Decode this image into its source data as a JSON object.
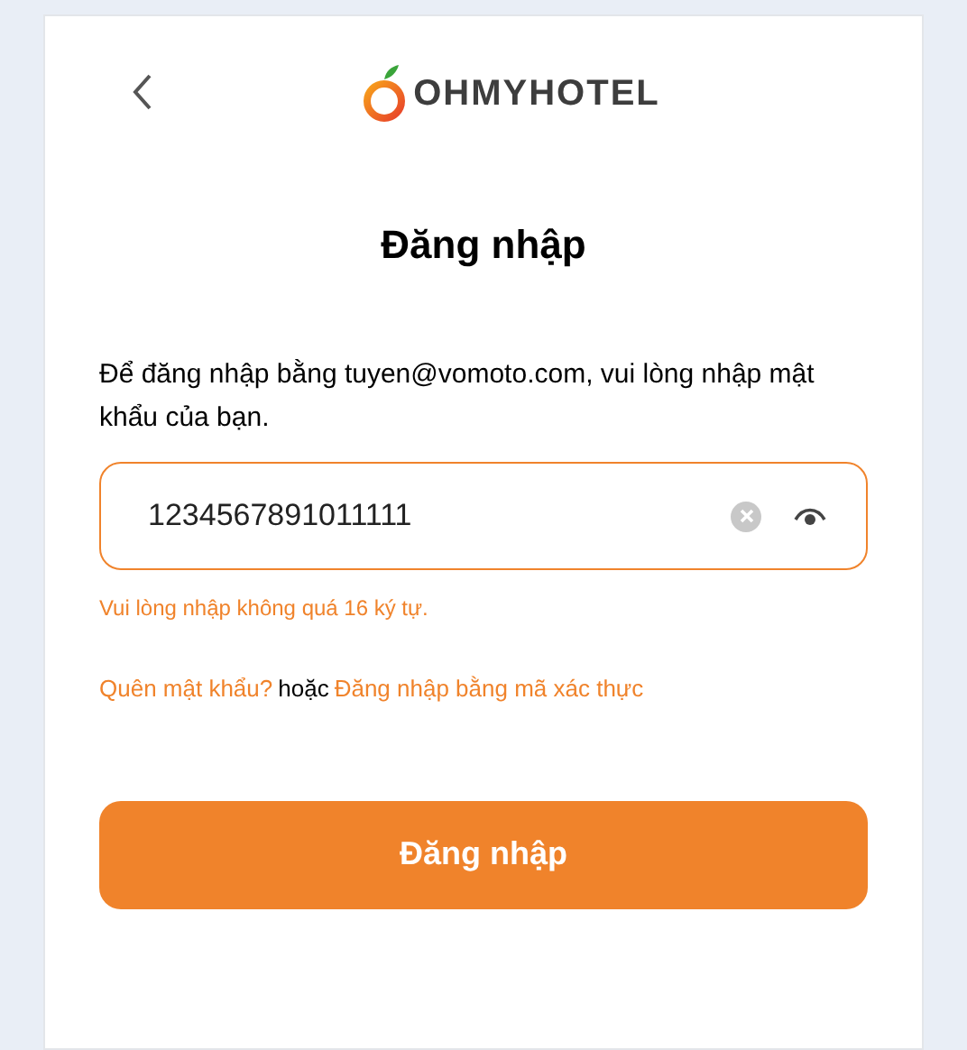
{
  "logo": {
    "text": "OHMYHOTEL"
  },
  "title": "Đăng nhập",
  "instruction": "Để đăng nhập bằng tuyen@vomoto.com, vui lòng nhập mật khẩu của bạn.",
  "password_field": {
    "value": "1234567891011111",
    "error": "Vui lòng nhập không quá 16 ký tự."
  },
  "links": {
    "forgot": "Quên mật khẩu?",
    "or": "hoặc",
    "otp": "Đăng nhập bằng mã xác thực"
  },
  "submit_button": "Đăng nhập"
}
